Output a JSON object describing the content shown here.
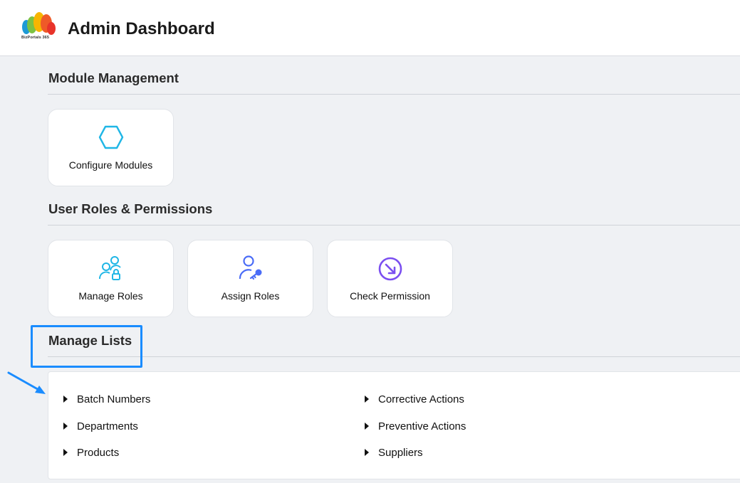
{
  "header": {
    "title": "Admin Dashboard",
    "logo_text": "BizPortals 365"
  },
  "sections": {
    "module_management": {
      "title": "Module Management",
      "tiles": [
        {
          "label": "Configure Modules",
          "icon": "hexagon-icon",
          "color": "#1fb6e6"
        }
      ]
    },
    "user_roles": {
      "title": "User Roles & Permissions",
      "tiles": [
        {
          "label": "Manage Roles",
          "icon": "users-lock-icon",
          "color": "#1fb6e6"
        },
        {
          "label": "Assign Roles",
          "icon": "user-key-icon",
          "color": "#4a6cf7"
        },
        {
          "label": "Check Permission",
          "icon": "arrow-circle-icon",
          "color": "#7b4ff0"
        }
      ]
    },
    "manage_lists": {
      "title": "Manage Lists",
      "items_left": [
        "Batch Numbers",
        "Departments",
        "Products"
      ],
      "items_right": [
        "Corrective Actions",
        "Preventive Actions",
        "Suppliers"
      ]
    }
  },
  "colors": {
    "highlight": "#1a8cff",
    "background": "#eff1f4"
  }
}
